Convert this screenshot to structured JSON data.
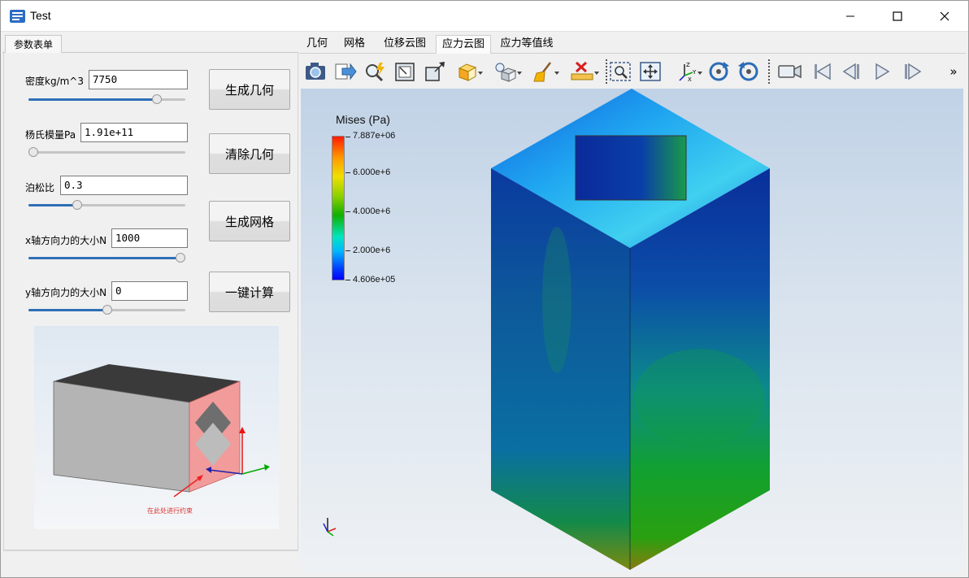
{
  "window": {
    "title": "Test",
    "minimize": "—",
    "maximize": "☐",
    "close": "✕"
  },
  "left_tab": {
    "label": "参数表单"
  },
  "params": [
    {
      "label": "密度kg/m^3",
      "value": "7750",
      "slider": 0.82
    },
    {
      "label": "杨氏模量Pa",
      "value": "1.91e+11",
      "slider": 0.0
    },
    {
      "label": "泊松比",
      "value": "0.3",
      "slider": 0.31
    },
    {
      "label": "x轴方向力的大小N",
      "value": "1000",
      "slider": 1.0
    },
    {
      "label": "y轴方向力的大小N",
      "value": "0",
      "slider": 0.5
    }
  ],
  "buttons": {
    "gen_geom": "生成几何",
    "clear_geom": "清除几何",
    "gen_mesh": "生成网格",
    "compute": "一键计算"
  },
  "preview": {
    "annotation": "在此处进行约束"
  },
  "tabs": [
    {
      "label": "几何"
    },
    {
      "label": "网格"
    },
    {
      "label": "位移云图"
    },
    {
      "label": "应力云图"
    },
    {
      "label": "应力等值线"
    }
  ],
  "active_tab": "应力云图",
  "toolbar_overflow": "»",
  "legend": {
    "title": "Mises (Pa)",
    "max": "7.887e+06",
    "labels": [
      "6.000e+6",
      "4.000e+6",
      "2.000e+6"
    ],
    "min": "4.606e+05"
  },
  "colors": {
    "accent": "#2f6fb6",
    "close_hover": "#e81123"
  }
}
